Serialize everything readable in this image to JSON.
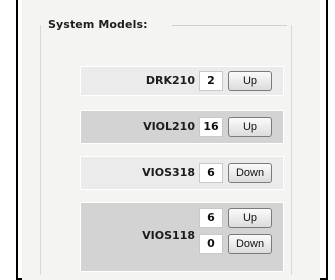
{
  "group": {
    "title": "System Models:"
  },
  "models": [
    {
      "name": "DRK210",
      "value": "2",
      "button": "Up"
    },
    {
      "name": "VIOL210",
      "value": "16",
      "button": "Up"
    },
    {
      "name": "VIOS318",
      "value": "6",
      "button": "Down"
    },
    {
      "name": "VIOS118",
      "controls": [
        {
          "value": "6",
          "button": "Up"
        },
        {
          "value": "0",
          "button": "Down"
        }
      ]
    }
  ]
}
